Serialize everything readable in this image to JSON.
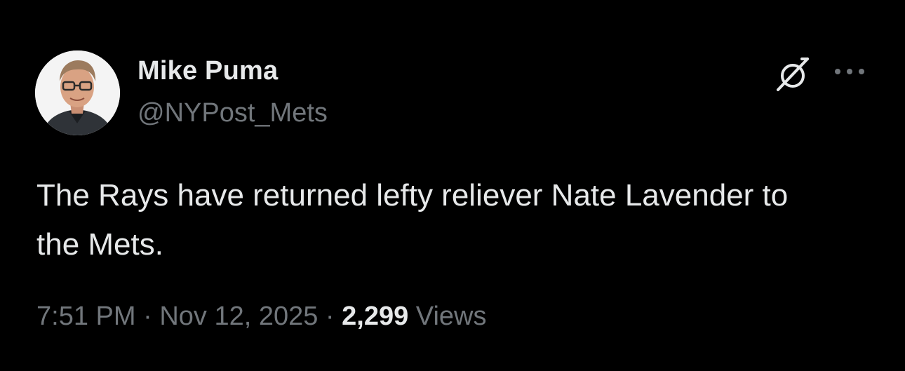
{
  "author": {
    "display_name": "Mike Puma",
    "handle": "@NYPost_Mets",
    "avatar_icon": "person-avatar"
  },
  "tweet": {
    "text": "The Rays have returned lefty reliever Nate Lavender to the Mets."
  },
  "meta": {
    "time": "7:51 PM",
    "separator1": " · ",
    "date": "Nov 12, 2025",
    "separator2": " · ",
    "views_count": "2,299",
    "views_label": " Views"
  },
  "actions": {
    "grok_icon": "grok-icon",
    "more_icon": "more-icon"
  },
  "colors": {
    "background": "#000000",
    "primary_text": "#e7e9ea",
    "secondary_text": "#71767b"
  }
}
